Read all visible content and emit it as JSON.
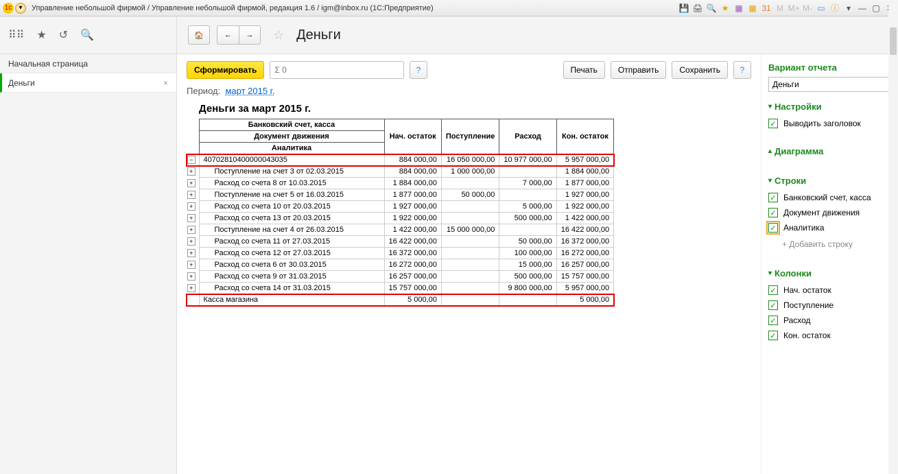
{
  "titlebar": {
    "text": "Управление небольшой фирмой / Управление небольшой фирмой, редакция 1.6 / igm@inbox.ru  (1С:Предприятие)"
  },
  "sidebar": {
    "items": [
      {
        "label": "Начальная страница",
        "active": false
      },
      {
        "label": "Деньги",
        "active": true
      }
    ]
  },
  "page": {
    "title": "Деньги"
  },
  "actions": {
    "generate": "Сформировать",
    "search_placeholder": "Σ 0",
    "print": "Печать",
    "send": "Отправить",
    "save": "Сохранить"
  },
  "period": {
    "label": "Период:",
    "value": "март 2015 г."
  },
  "report": {
    "title": "Деньги за март 2015 г.",
    "header1": "Банковский счет, касса",
    "header2": "Документ движения",
    "header3": "Аналитика",
    "cols": [
      "Нач. остаток",
      "Поступление",
      "Расход",
      "Кон. остаток"
    ],
    "rows": [
      {
        "exp": "minus",
        "name": "40702810400000043035",
        "v": [
          "884 000,00",
          "16 050 000,00",
          "10 977 000,00",
          "5 957 000,00"
        ],
        "hl": true,
        "lvl": 0
      },
      {
        "exp": "plus",
        "name": "Поступление на счет 3 от 02.03.2015",
        "v": [
          "884 000,00",
          "1 000 000,00",
          "",
          "1 884 000,00"
        ],
        "lvl": 1
      },
      {
        "exp": "plus",
        "name": "Расход со счета 8 от 10.03.2015",
        "v": [
          "1 884 000,00",
          "",
          "7 000,00",
          "1 877 000,00"
        ],
        "lvl": 1
      },
      {
        "exp": "plus",
        "name": "Поступление на счет 5 от 16.03.2015",
        "v": [
          "1 877 000,00",
          "50 000,00",
          "",
          "1 927 000,00"
        ],
        "lvl": 1
      },
      {
        "exp": "plus",
        "name": "Расход со счета 10 от 20.03.2015",
        "v": [
          "1 927 000,00",
          "",
          "5 000,00",
          "1 922 000,00"
        ],
        "lvl": 1
      },
      {
        "exp": "plus",
        "name": "Расход со счета 13 от 20.03.2015",
        "v": [
          "1 922 000,00",
          "",
          "500 000,00",
          "1 422 000,00"
        ],
        "lvl": 1
      },
      {
        "exp": "plus",
        "name": "Поступление на счет 4 от 26.03.2015",
        "v": [
          "1 422 000,00",
          "15 000 000,00",
          "",
          "16 422 000,00"
        ],
        "lvl": 1
      },
      {
        "exp": "plus",
        "name": "Расход со счета 11 от 27.03.2015",
        "v": [
          "16 422 000,00",
          "",
          "50 000,00",
          "16 372 000,00"
        ],
        "lvl": 1
      },
      {
        "exp": "plus",
        "name": "Расход со счета 12 от 27.03.2015",
        "v": [
          "16 372 000,00",
          "",
          "100 000,00",
          "16 272 000,00"
        ],
        "lvl": 1
      },
      {
        "exp": "plus",
        "name": "Расход со счета 6 от 30.03.2015",
        "v": [
          "16 272 000,00",
          "",
          "15 000,00",
          "16 257 000,00"
        ],
        "lvl": 1
      },
      {
        "exp": "plus",
        "name": "Расход со счета 9 от 31.03.2015",
        "v": [
          "16 257 000,00",
          "",
          "500 000,00",
          "15 757 000,00"
        ],
        "lvl": 1
      },
      {
        "exp": "plus",
        "name": "Расход со счета 14 от 31.03.2015",
        "v": [
          "15 757 000,00",
          "",
          "9 800 000,00",
          "5 957 000,00"
        ],
        "lvl": 1
      },
      {
        "exp": "",
        "name": "Касса магазина",
        "v": [
          "5 000,00",
          "",
          "",
          "5 000,00"
        ],
        "hl": true,
        "lvl": 0
      }
    ]
  },
  "settings": {
    "variant_title": "Вариант отчета",
    "variant_value": "Деньги",
    "sec_settings": "Настройки",
    "show_header": "Выводить заголовок",
    "sec_diagram": "Диаграмма",
    "sec_rows": "Строки",
    "rows": [
      "Банковский счет, касса",
      "Документ движения",
      "Аналитика"
    ],
    "add_row": "+ Добавить строку",
    "sec_cols": "Колонки",
    "cols": [
      "Нач. остаток",
      "Поступление",
      "Расход",
      "Кон. остаток"
    ]
  }
}
